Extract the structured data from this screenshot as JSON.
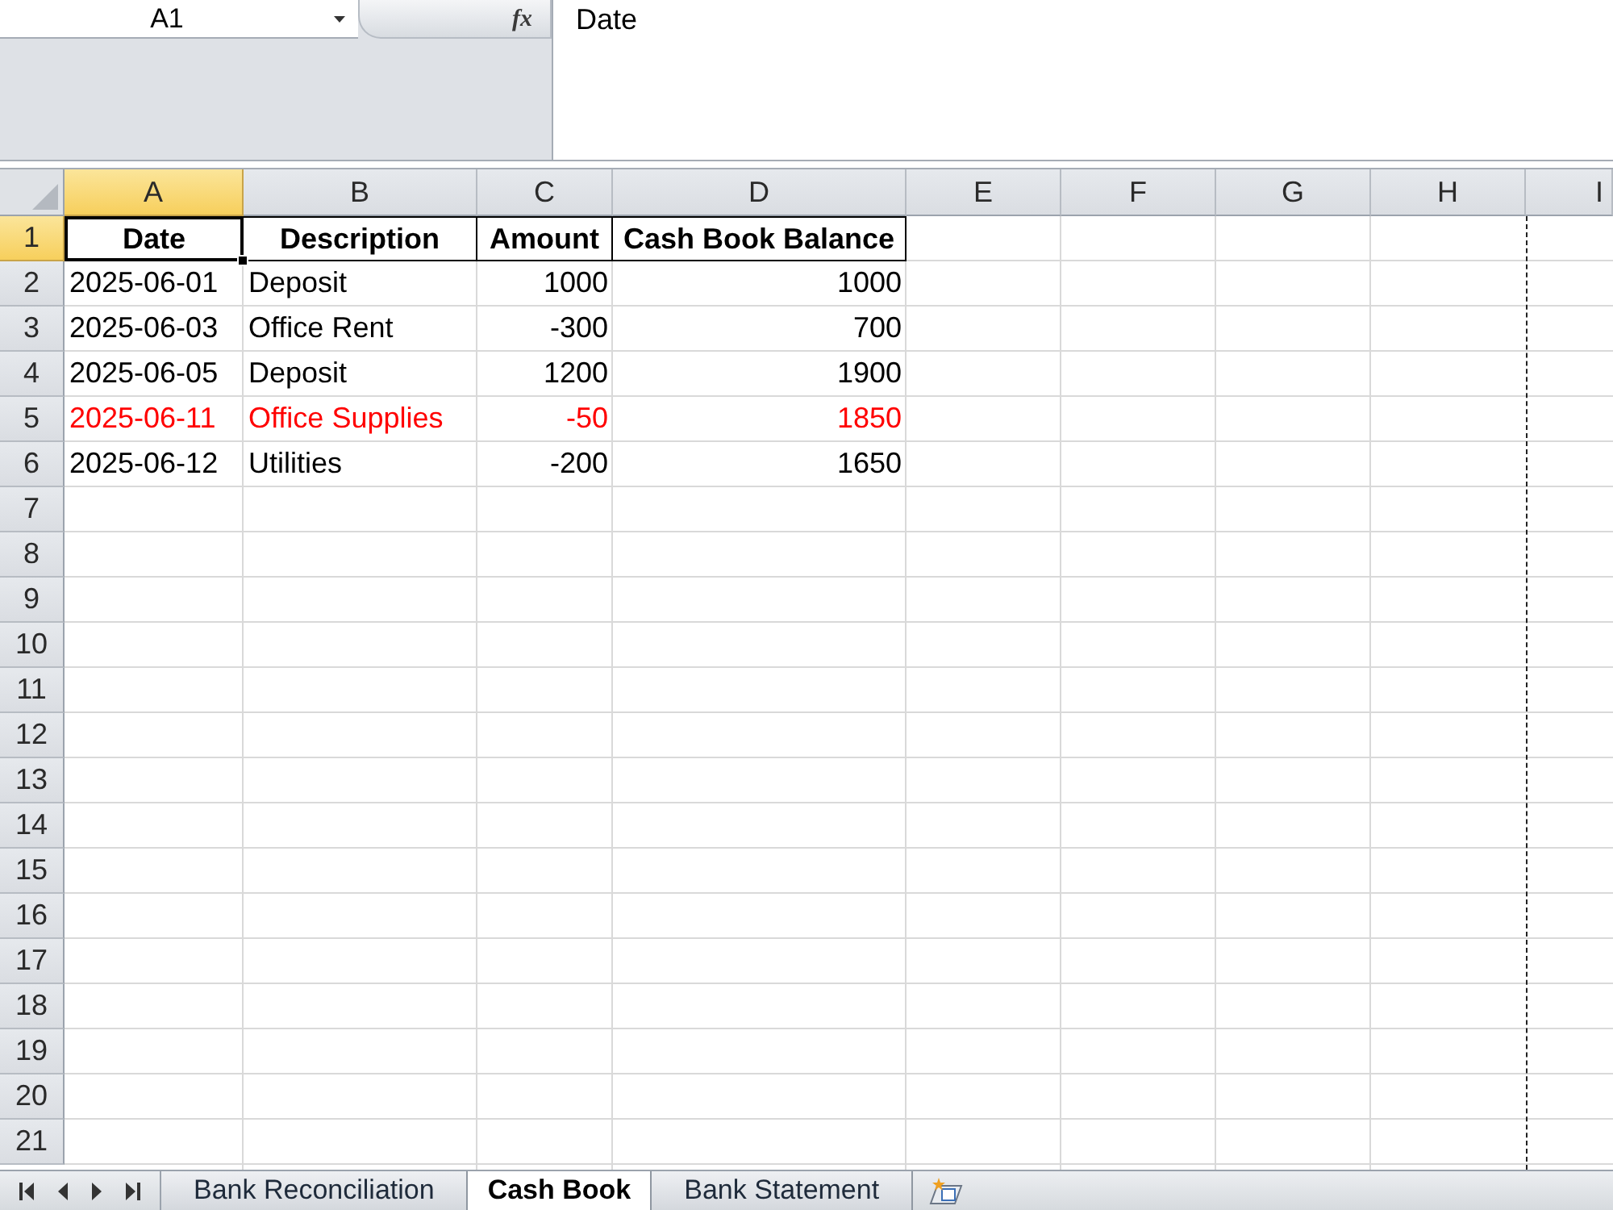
{
  "name_box": {
    "value": "A1"
  },
  "formula_bar": {
    "function_label": "fx",
    "value": "Date"
  },
  "columns": [
    {
      "label": "A",
      "selected": true
    },
    {
      "label": "B",
      "selected": false
    },
    {
      "label": "C",
      "selected": false
    },
    {
      "label": "D",
      "selected": false
    },
    {
      "label": "E",
      "selected": false
    },
    {
      "label": "F",
      "selected": false
    },
    {
      "label": "G",
      "selected": false
    },
    {
      "label": "H",
      "selected": false
    },
    {
      "label": "I",
      "selected": false
    }
  ],
  "rows": [
    {
      "label": "1",
      "selected": true,
      "kind": "header",
      "cells": [
        "Date",
        "Description",
        "Amount",
        "Cash Book Balance"
      ]
    },
    {
      "label": "2",
      "selected": false,
      "kind": "entry",
      "color": "#000000",
      "cells": [
        "2025-06-01",
        "Deposit",
        "1000",
        "1000"
      ]
    },
    {
      "label": "3",
      "selected": false,
      "kind": "entry",
      "color": "#000000",
      "cells": [
        "2025-06-03",
        "Office Rent",
        "-300",
        "700"
      ]
    },
    {
      "label": "4",
      "selected": false,
      "kind": "entry",
      "color": "#000000",
      "cells": [
        "2025-06-05",
        "Deposit",
        "1200",
        "1900"
      ]
    },
    {
      "label": "5",
      "selected": false,
      "kind": "entry",
      "color": "#ff0000",
      "cells": [
        "2025-06-11",
        "Office Supplies",
        "-50",
        "1850"
      ]
    },
    {
      "label": "6",
      "selected": false,
      "kind": "entry",
      "color": "#000000",
      "cells": [
        "2025-06-12",
        "Utilities",
        "-200",
        "1650"
      ]
    },
    {
      "label": "7",
      "selected": false
    },
    {
      "label": "8",
      "selected": false
    },
    {
      "label": "9",
      "selected": false
    },
    {
      "label": "10",
      "selected": false
    },
    {
      "label": "11",
      "selected": false
    },
    {
      "label": "12",
      "selected": false
    },
    {
      "label": "13",
      "selected": false
    },
    {
      "label": "14",
      "selected": false
    },
    {
      "label": "15",
      "selected": false
    },
    {
      "label": "16",
      "selected": false
    },
    {
      "label": "17",
      "selected": false
    },
    {
      "label": "18",
      "selected": false
    },
    {
      "label": "19",
      "selected": false
    },
    {
      "label": "20",
      "selected": false
    },
    {
      "label": "21",
      "selected": false
    }
  ],
  "sheet_tabs": [
    {
      "label": "Bank Reconciliation",
      "selected": false
    },
    {
      "label": "Cash Book",
      "selected": true
    },
    {
      "label": "Bank Statement",
      "selected": false
    }
  ]
}
